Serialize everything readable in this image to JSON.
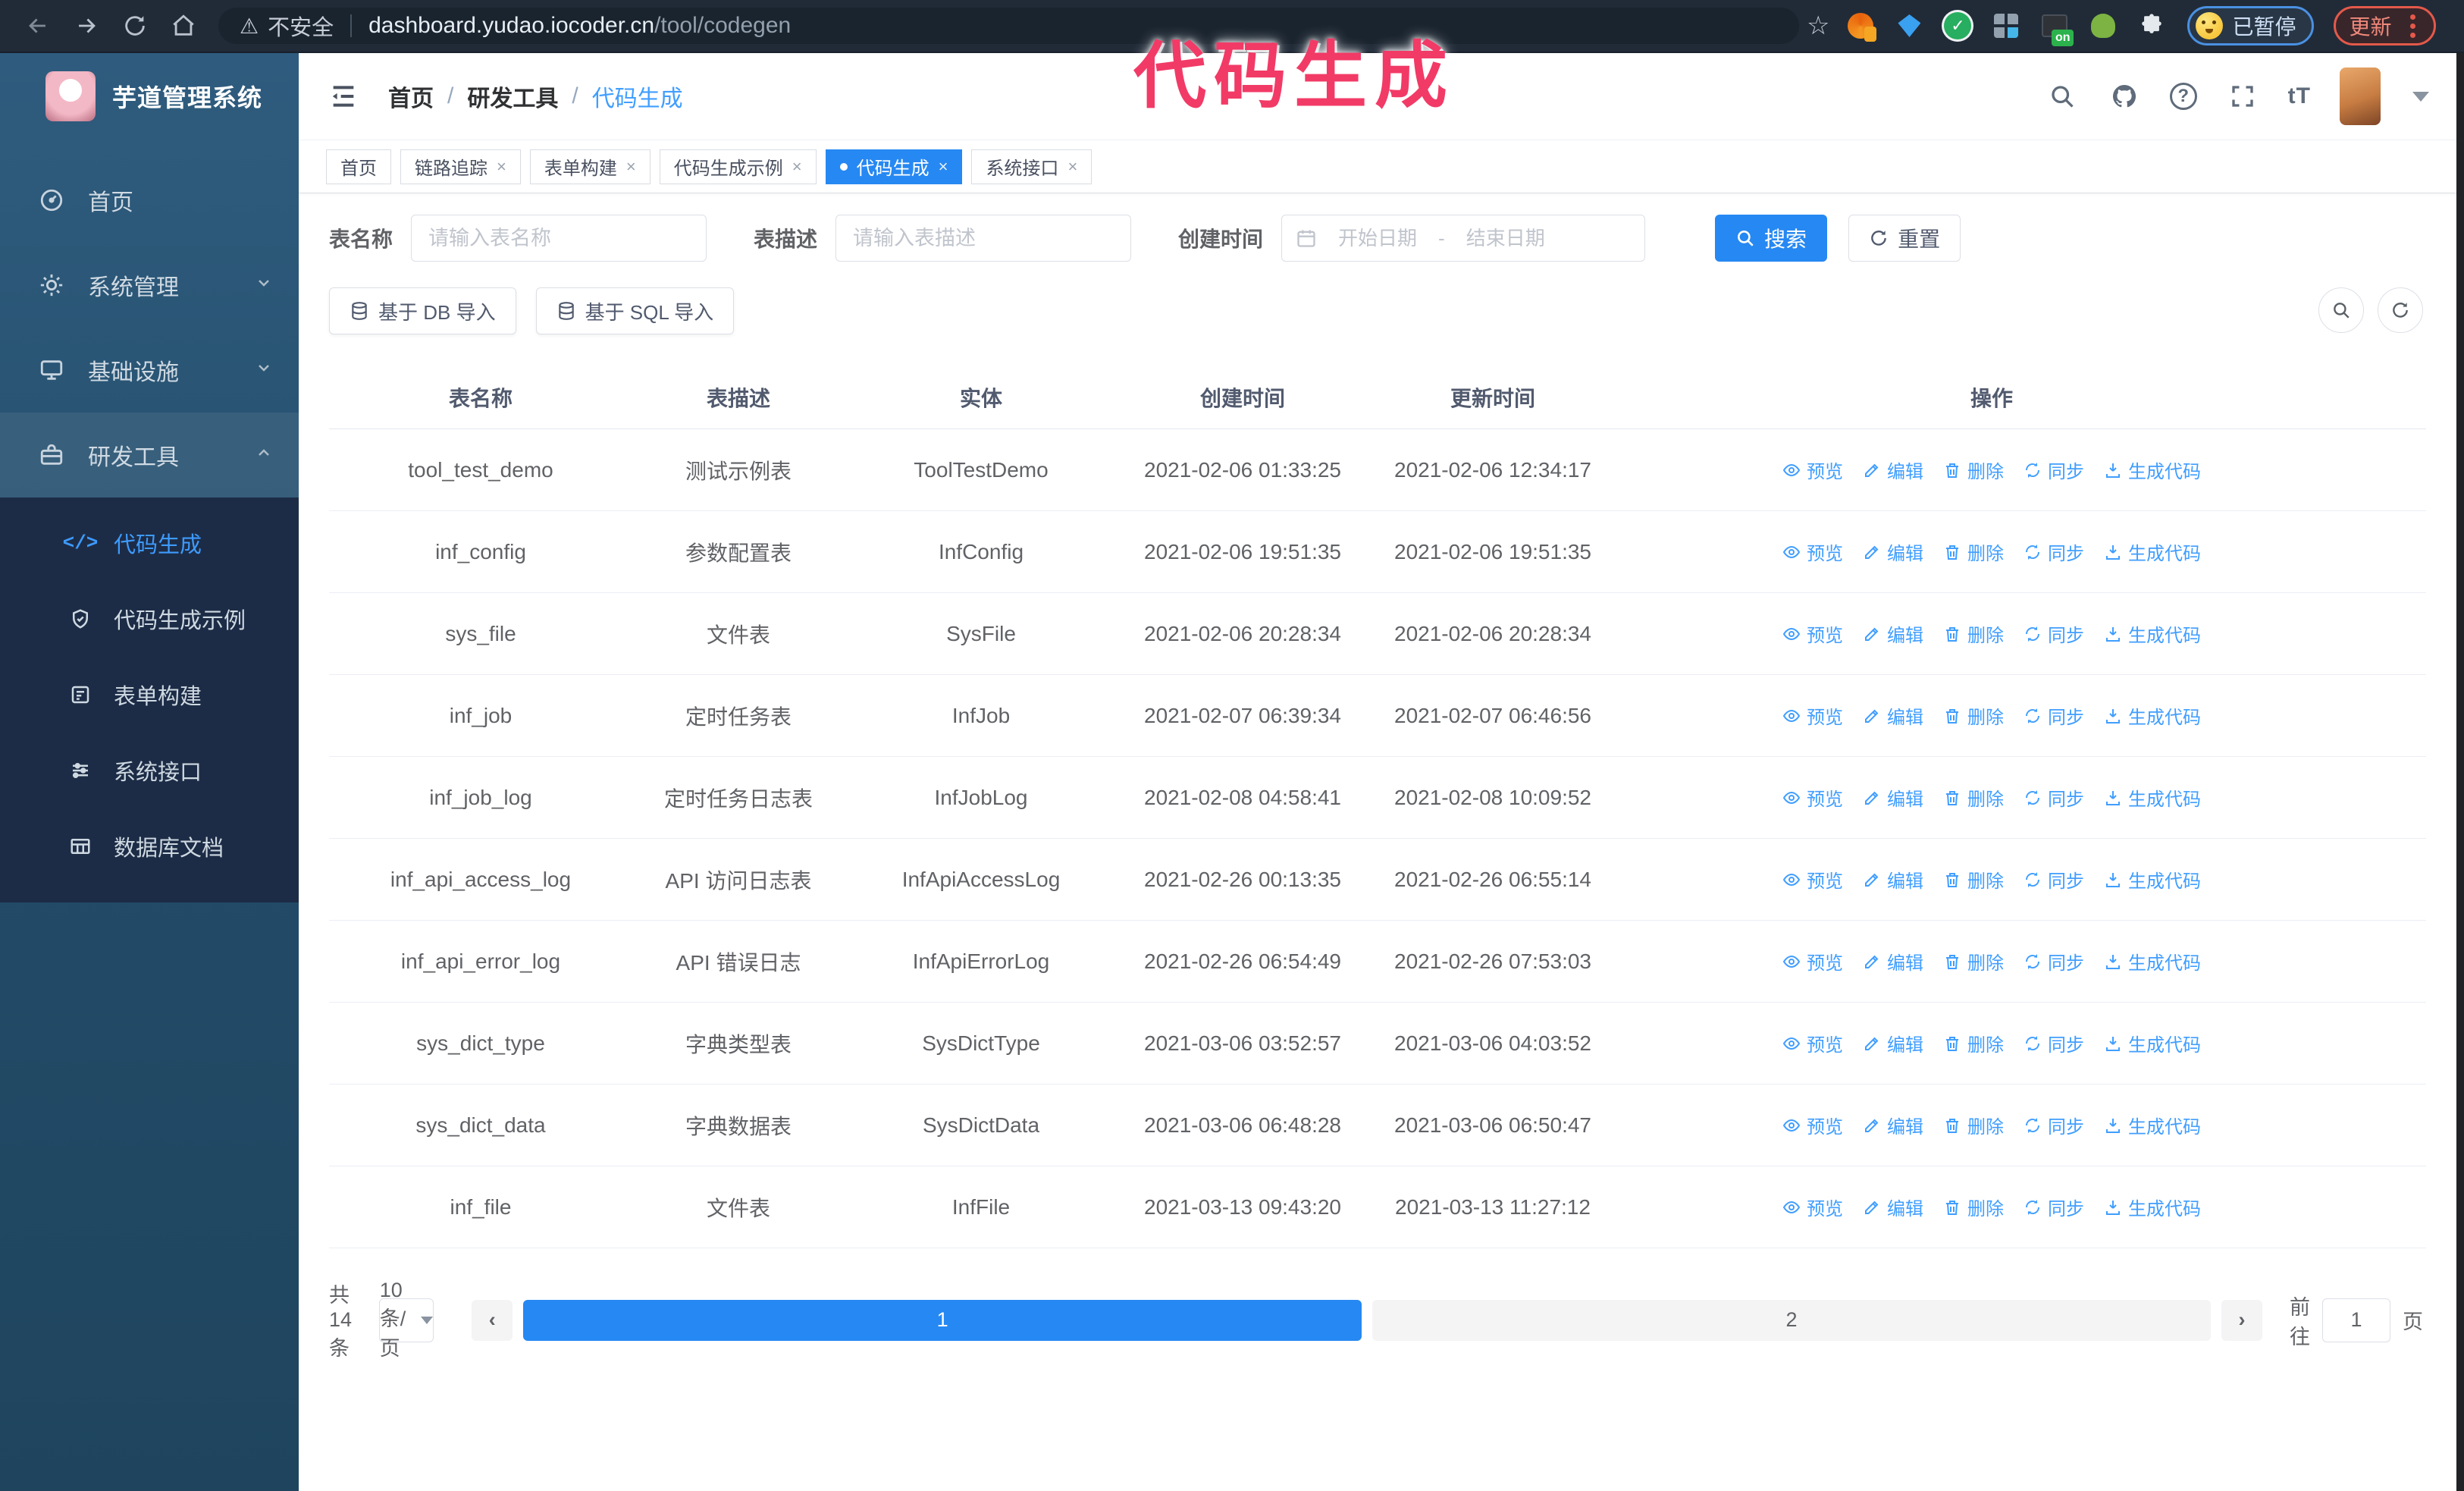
{
  "browser": {
    "security_label": "不安全",
    "url_host": "dashboard.yudao.iocoder.cn",
    "url_path": "/tool/codegen",
    "extension_on_badge": "on",
    "profile_badge": "已暂停",
    "update_button": "更新"
  },
  "annotation": {
    "text": "代码生成",
    "color": "#f23a66"
  },
  "icons": {
    "star": "☆",
    "warning": "⚠",
    "question": "?",
    "font_size": "tT",
    "code_glyph": "</>",
    "check": "✓"
  },
  "sidebar": {
    "logo_title": "芋道管理系统",
    "items": [
      {
        "label": "首页"
      },
      {
        "label": "系统管理"
      },
      {
        "label": "基础设施"
      },
      {
        "label": "研发工具"
      }
    ],
    "submenu": [
      {
        "label": "代码生成"
      },
      {
        "label": "代码生成示例"
      },
      {
        "label": "表单构建"
      },
      {
        "label": "系统接口"
      },
      {
        "label": "数据库文档"
      }
    ]
  },
  "breadcrumb": {
    "separator": "/",
    "items": [
      "首页",
      "研发工具",
      "代码生成"
    ]
  },
  "tabs": [
    {
      "label": "首页"
    },
    {
      "label": "链路追踪"
    },
    {
      "label": "表单构建"
    },
    {
      "label": "代码生成示例"
    },
    {
      "label": "代码生成"
    },
    {
      "label": "系统接口"
    }
  ],
  "search_form": {
    "table_name_label": "表名称",
    "table_name_placeholder": "请输入表名称",
    "table_desc_label": "表描述",
    "table_desc_placeholder": "请输入表描述",
    "create_time_label": "创建时间",
    "date_start_placeholder": "开始日期",
    "date_separator": "-",
    "date_end_placeholder": "结束日期",
    "search_button": "搜索",
    "reset_button": "重置"
  },
  "toolbar": {
    "import_db_button": "基于 DB 导入",
    "import_sql_button": "基于 SQL 导入"
  },
  "table": {
    "columns": [
      "表名称",
      "表描述",
      "实体",
      "创建时间",
      "更新时间",
      "操作"
    ],
    "actions": [
      "预览",
      "编辑",
      "删除",
      "同步",
      "生成代码"
    ],
    "rows": [
      {
        "name": "tool_test_demo",
        "desc": "测试示例表",
        "entity": "ToolTestDemo",
        "created": "2021-02-06 01:33:25",
        "updated": "2021-02-06 12:34:17"
      },
      {
        "name": "inf_config",
        "desc": "参数配置表",
        "entity": "InfConfig",
        "created": "2021-02-06 19:51:35",
        "updated": "2021-02-06 19:51:35"
      },
      {
        "name": "sys_file",
        "desc": "文件表",
        "entity": "SysFile",
        "created": "2021-02-06 20:28:34",
        "updated": "2021-02-06 20:28:34"
      },
      {
        "name": "inf_job",
        "desc": "定时任务表",
        "entity": "InfJob",
        "created": "2021-02-07 06:39:34",
        "updated": "2021-02-07 06:46:56"
      },
      {
        "name": "inf_job_log",
        "desc": "定时任务日志表",
        "entity": "InfJobLog",
        "created": "2021-02-08 04:58:41",
        "updated": "2021-02-08 10:09:52"
      },
      {
        "name": "inf_api_access_log",
        "desc": "API 访问日志表",
        "entity": "InfApiAccessLog",
        "created": "2021-02-26 00:13:35",
        "updated": "2021-02-26 06:55:14"
      },
      {
        "name": "inf_api_error_log",
        "desc": "API 错误日志",
        "entity": "InfApiErrorLog",
        "created": "2021-02-26 06:54:49",
        "updated": "2021-02-26 07:53:03"
      },
      {
        "name": "sys_dict_type",
        "desc": "字典类型表",
        "entity": "SysDictType",
        "created": "2021-03-06 03:52:57",
        "updated": "2021-03-06 04:03:52"
      },
      {
        "name": "sys_dict_data",
        "desc": "字典数据表",
        "entity": "SysDictData",
        "created": "2021-03-06 06:48:28",
        "updated": "2021-03-06 06:50:47"
      },
      {
        "name": "inf_file",
        "desc": "文件表",
        "entity": "InfFile",
        "created": "2021-03-13 09:43:20",
        "updated": "2021-03-13 11:27:12"
      }
    ]
  },
  "pagination": {
    "total_label": "共 14 条",
    "page_size": "10条/页",
    "pages": [
      "1",
      "2"
    ],
    "active_page": "1",
    "goto_label": "前往",
    "goto_value": "1",
    "goto_suffix": "页"
  },
  "colors": {
    "primary_blue": "#2688f2",
    "link_blue": "#409eff",
    "annotation_pink": "#f23a66",
    "sidebar_top": "#2f5c7e",
    "sidebar_bottom": "#1f455e",
    "submenu_bg": "#1d2c46",
    "chrome_bg": "#212b38"
  }
}
